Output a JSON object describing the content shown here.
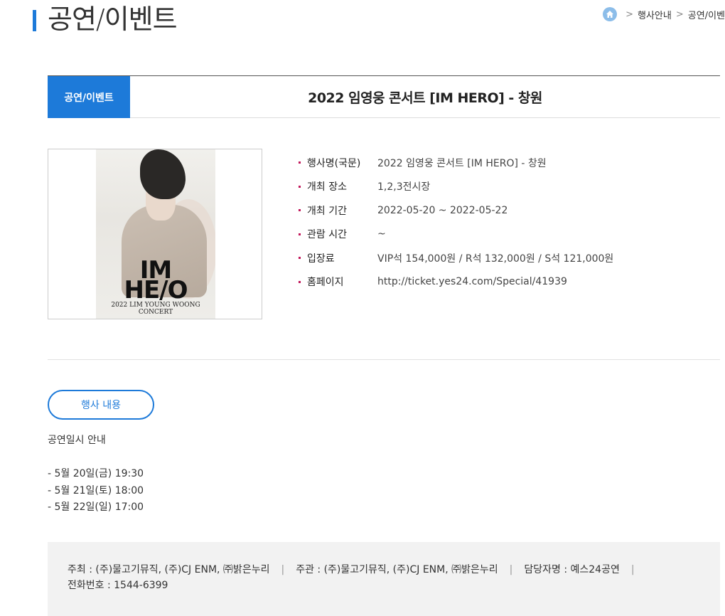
{
  "page": {
    "title": "공연/이벤트"
  },
  "breadcrumb": {
    "items": [
      "행사안내",
      "공연/이벤"
    ]
  },
  "event": {
    "category": "공연/이벤트",
    "title": "2022 임영웅 콘서트 [IM HERO] - 창원",
    "poster": {
      "line1": "IM",
      "line2": "HE/O",
      "sub1": "2022 LIM YOUNG WOONG",
      "sub2": "CONCERT"
    },
    "info": [
      {
        "label": "행사명(국문)",
        "value": "2022 임영웅 콘서트 [IM HERO] - 창원"
      },
      {
        "label": "개최 장소",
        "value": "1,2,3전시장"
      },
      {
        "label": "개최 기간",
        "value": "2022-05-20 ~ 2022-05-22"
      },
      {
        "label": "관람 시간",
        "value": "~"
      },
      {
        "label": "입장료",
        "value": "VIP석 154,000원 / R석 132,000원 / S석 121,000원"
      },
      {
        "label": "홈페이지",
        "value": "http://ticket.yes24.com/Special/41939"
      }
    ]
  },
  "content": {
    "button_label": "행사 내용",
    "heading": "공연일시 안내",
    "schedule": [
      "- 5월 20일(금) 19:30",
      "- 5월 21일(토) 18:00",
      "- 5월 22일(일) 17:00"
    ]
  },
  "footer": {
    "host": "주최 : (주)물고기뮤직, (주)CJ ENM, ㈜밝은누리",
    "organizer": "주관 : (주)물고기뮤직, (주)CJ ENM, ㈜밝은누리",
    "contact_name": "담당자명 : 예스24공연",
    "phone": "전화번호 : 1544-6399",
    "separator": "|"
  },
  "colors": {
    "accent": "#1d7ad9",
    "bullet": "#c2185b",
    "footer_bg": "#f2f2f2"
  },
  "icons": {
    "home": "home-icon",
    "breadcrumb_separator": "chevron-right-icon"
  }
}
